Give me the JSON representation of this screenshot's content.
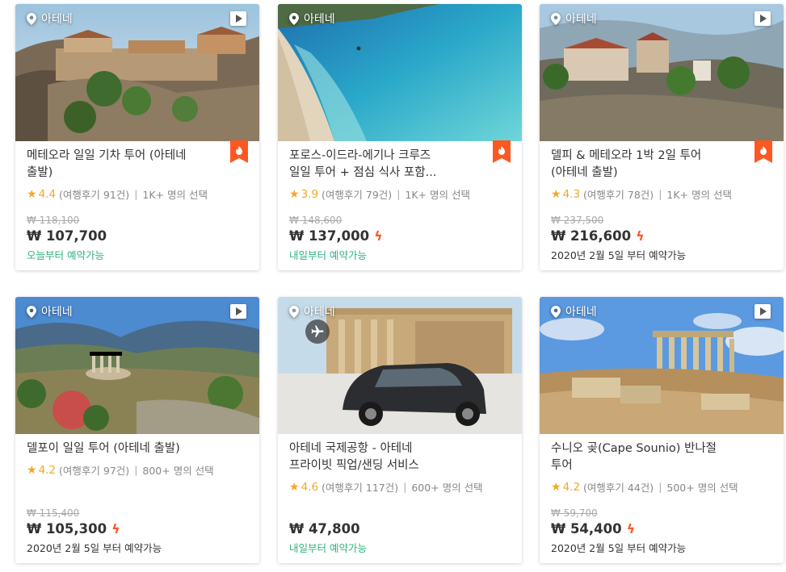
{
  "currency_symbol": "₩",
  "location_label": "아테네",
  "colors": {
    "accent_orange": "#ff5722",
    "star": "#f5a623",
    "available_green": "#2fb37c"
  },
  "cards": [
    {
      "title_line1": "메테오라 일일 기차 투어 (아테네",
      "title_line2": "출발)",
      "rating": "4.4",
      "reviews": "(여행후기 91건)",
      "selected": "1K+ 명의 선택",
      "original_price": "₩ 118,100",
      "price": "₩ 107,700",
      "instant": false,
      "availability": "오늘부터 예약가능",
      "availability_style": "green",
      "hot_badge": true,
      "video": true,
      "airport": false
    },
    {
      "title_line1": "포로스-이드라-에기나 크루즈",
      "title_line2": "일일 투어 + 점심 식사 포함...",
      "rating": "3.9",
      "reviews": "(여행후기 79건)",
      "selected": "1K+ 명의 선택",
      "original_price": "₩ 148,600",
      "price": "₩ 137,000",
      "instant": true,
      "availability": "내일부터 예약가능",
      "availability_style": "green",
      "hot_badge": true,
      "video": false,
      "airport": false
    },
    {
      "title_line1": "델피 & 메테오라 1박 2일 투어",
      "title_line2": "(아테네 출발)",
      "rating": "4.3",
      "reviews": "(여행후기 78건)",
      "selected": "1K+ 명의 선택",
      "original_price": "₩ 237,500",
      "price": "₩ 216,600",
      "instant": true,
      "availability": "2020년 2월 5일 부터 예약가능",
      "availability_style": "gray",
      "hot_badge": true,
      "video": true,
      "airport": false
    },
    {
      "title_line1": "델포이 일일 투어 (아테네 출발)",
      "title_line2": "",
      "rating": "4.2",
      "reviews": "(여행후기 97건)",
      "selected": "800+ 명의 선택",
      "original_price": "₩ 115,400",
      "price": "₩ 105,300",
      "instant": true,
      "availability": "2020년 2월 5일 부터 예약가능",
      "availability_style": "gray",
      "hot_badge": false,
      "video": true,
      "airport": false
    },
    {
      "title_line1": "아테네 국제공항 - 아테네",
      "title_line2": "프라이빗 픽업/샌딩 서비스",
      "rating": "4.6",
      "reviews": "(여행후기 117건)",
      "selected": "600+ 명의 선택",
      "original_price": "",
      "price": "₩ 47,800",
      "instant": false,
      "availability": "내일부터 예약가능",
      "availability_style": "green",
      "hot_badge": false,
      "video": false,
      "airport": true
    },
    {
      "title_line1": "수니오 곶(Cape Sounio) 반나절",
      "title_line2": "투어",
      "rating": "4.2",
      "reviews": "(여행후기 44건)",
      "selected": "500+ 명의 선택",
      "original_price": "₩ 59,700",
      "price": "₩ 54,400",
      "instant": true,
      "availability": "2020년 2월 5일 부터 예약가능",
      "availability_style": "gray",
      "hot_badge": false,
      "video": true,
      "airport": false
    }
  ]
}
